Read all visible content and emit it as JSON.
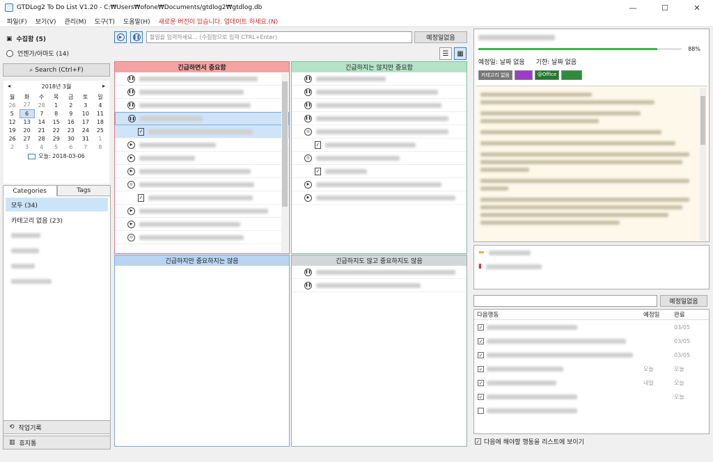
{
  "window": {
    "title": "GTDLog2 To Do List V1.20 - C:₩Users₩ofone₩Documents/gtdlog2₩gtdlog.db",
    "minimize": "—",
    "maximize": "☐",
    "close": "✕"
  },
  "menu": [
    "파일(F)",
    "보기(V)",
    "관리(M)",
    "도구(T)",
    "도움말(H)"
  ],
  "menu_notice": "새로운 버전이 있습니다. 업데이트 하세요.(N)",
  "sidebar": {
    "inbox": "수집함 (5)",
    "someday": "언젠가/아마도 (14)",
    "search": "Search (Ctrl+F)",
    "work_log": "작업기록",
    "trash": "휴지통"
  },
  "calendar": {
    "month": "2018년 3월",
    "weekdays": [
      "월",
      "화",
      "수",
      "목",
      "금",
      "토",
      "일"
    ],
    "weeks": [
      [
        "26",
        "27",
        "28",
        "1",
        "2",
        "3",
        "4"
      ],
      [
        "5",
        "6",
        "7",
        "8",
        "9",
        "10",
        "11"
      ],
      [
        "12",
        "13",
        "14",
        "15",
        "16",
        "17",
        "18"
      ],
      [
        "19",
        "20",
        "21",
        "22",
        "23",
        "24",
        "25"
      ],
      [
        "26",
        "27",
        "28",
        "29",
        "30",
        "31",
        "1"
      ],
      [
        "2",
        "3",
        "4",
        "5",
        "6",
        "7",
        "8"
      ]
    ],
    "today": "오늘: 2018-03-06"
  },
  "cat_tabs": [
    "Categories",
    "Tags"
  ],
  "categories": [
    "모두 (34)",
    "카테고리 없음 (23)"
  ],
  "center": {
    "input_placeholder": "할일을 입력하세요... (수집함으로 입력 CTRL+Enter)",
    "schedule_button": "예정일없음",
    "q1_title": "긴급하면서 중요함",
    "q2_title": "긴급하지는 않지만 중요함",
    "q3_title": "긴급하지만 중요하지는 않음",
    "q4_title": "긴급하지도 않고 중요하지도 않음"
  },
  "detail": {
    "progress_pct": 88,
    "progress_label": "88%",
    "scheduled": "예정일: 날짜 없음",
    "deadline": "기한: 날짜 없음",
    "tags": [
      {
        "text": "카테고리 없음",
        "color": "#777777"
      },
      {
        "text": "",
        "color": "#9a3ec8"
      },
      {
        "text": "@Office",
        "color": "#1f7a2c"
      },
      {
        "text": "",
        "color": "#2e8b3a"
      }
    ]
  },
  "next": {
    "schedule_button": "예정일없음",
    "headers": [
      "다음행동",
      "예정일",
      "완료"
    ],
    "rows": [
      {
        "checked": true,
        "sched": "",
        "done": "03/05"
      },
      {
        "checked": true,
        "sched": "",
        "done": "03/05"
      },
      {
        "checked": true,
        "sched": "",
        "done": "03/05"
      },
      {
        "checked": true,
        "sched": "오늘",
        "done": "오늘"
      },
      {
        "checked": true,
        "sched": "내일",
        "done": "오늘"
      },
      {
        "checked": true,
        "sched": "",
        "done": "오늘"
      },
      {
        "checked": false,
        "sched": "",
        "done": ""
      }
    ],
    "show_label": "다음에 해야할 행동을 리스트에 보이기"
  }
}
